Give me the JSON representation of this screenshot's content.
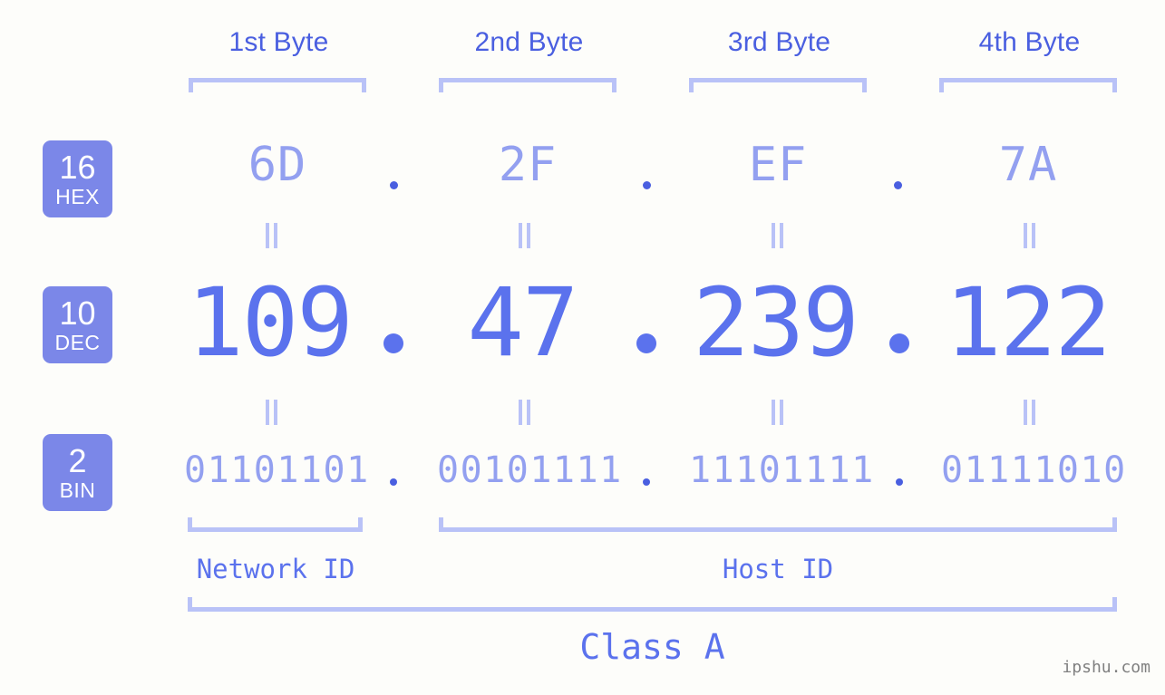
{
  "meta": {
    "background_color": "#fdfdfa",
    "accent_color": "#5b72ed",
    "badge_color": "#7b87e8",
    "bracket_color": "#b9c2f7",
    "light_value_color": "#93a0f0",
    "header_color": "#4a5fe0",
    "watermark_color": "#808080"
  },
  "byte_headers": [
    {
      "label": "1st Byte"
    },
    {
      "label": "2nd Byte"
    },
    {
      "label": "3rd Byte"
    },
    {
      "label": "4th Byte"
    }
  ],
  "bases": [
    {
      "number": "16",
      "label": "HEX"
    },
    {
      "number": "10",
      "label": "DEC"
    },
    {
      "number": "2",
      "label": "BIN"
    }
  ],
  "rows": {
    "hex": {
      "base": "16",
      "name": "HEX",
      "values": [
        "6D",
        "2F",
        "EF",
        "7A"
      ],
      "separator": "."
    },
    "dec": {
      "base": "10",
      "name": "DEC",
      "values": [
        "109",
        "47",
        "239",
        "122"
      ],
      "separator": "."
    },
    "bin": {
      "base": "2",
      "name": "BIN",
      "values": [
        "01101101",
        "00101111",
        "11101111",
        "01111010"
      ],
      "separator": "."
    }
  },
  "equals": {
    "glyph": "=",
    "count_per_row": 4
  },
  "address": {
    "dotted_decimal": "109.47.239.122",
    "hex": "6D.2F.EF.7A",
    "binary": "01101101.00101111.11101111.01111010"
  },
  "segments": {
    "network_id": {
      "label": "Network ID",
      "bytes": [
        1
      ]
    },
    "host_id": {
      "label": "Host ID",
      "bytes": [
        2,
        3,
        4
      ]
    }
  },
  "class": {
    "label": "Class A"
  },
  "watermark": {
    "text": "ipshu.com"
  }
}
